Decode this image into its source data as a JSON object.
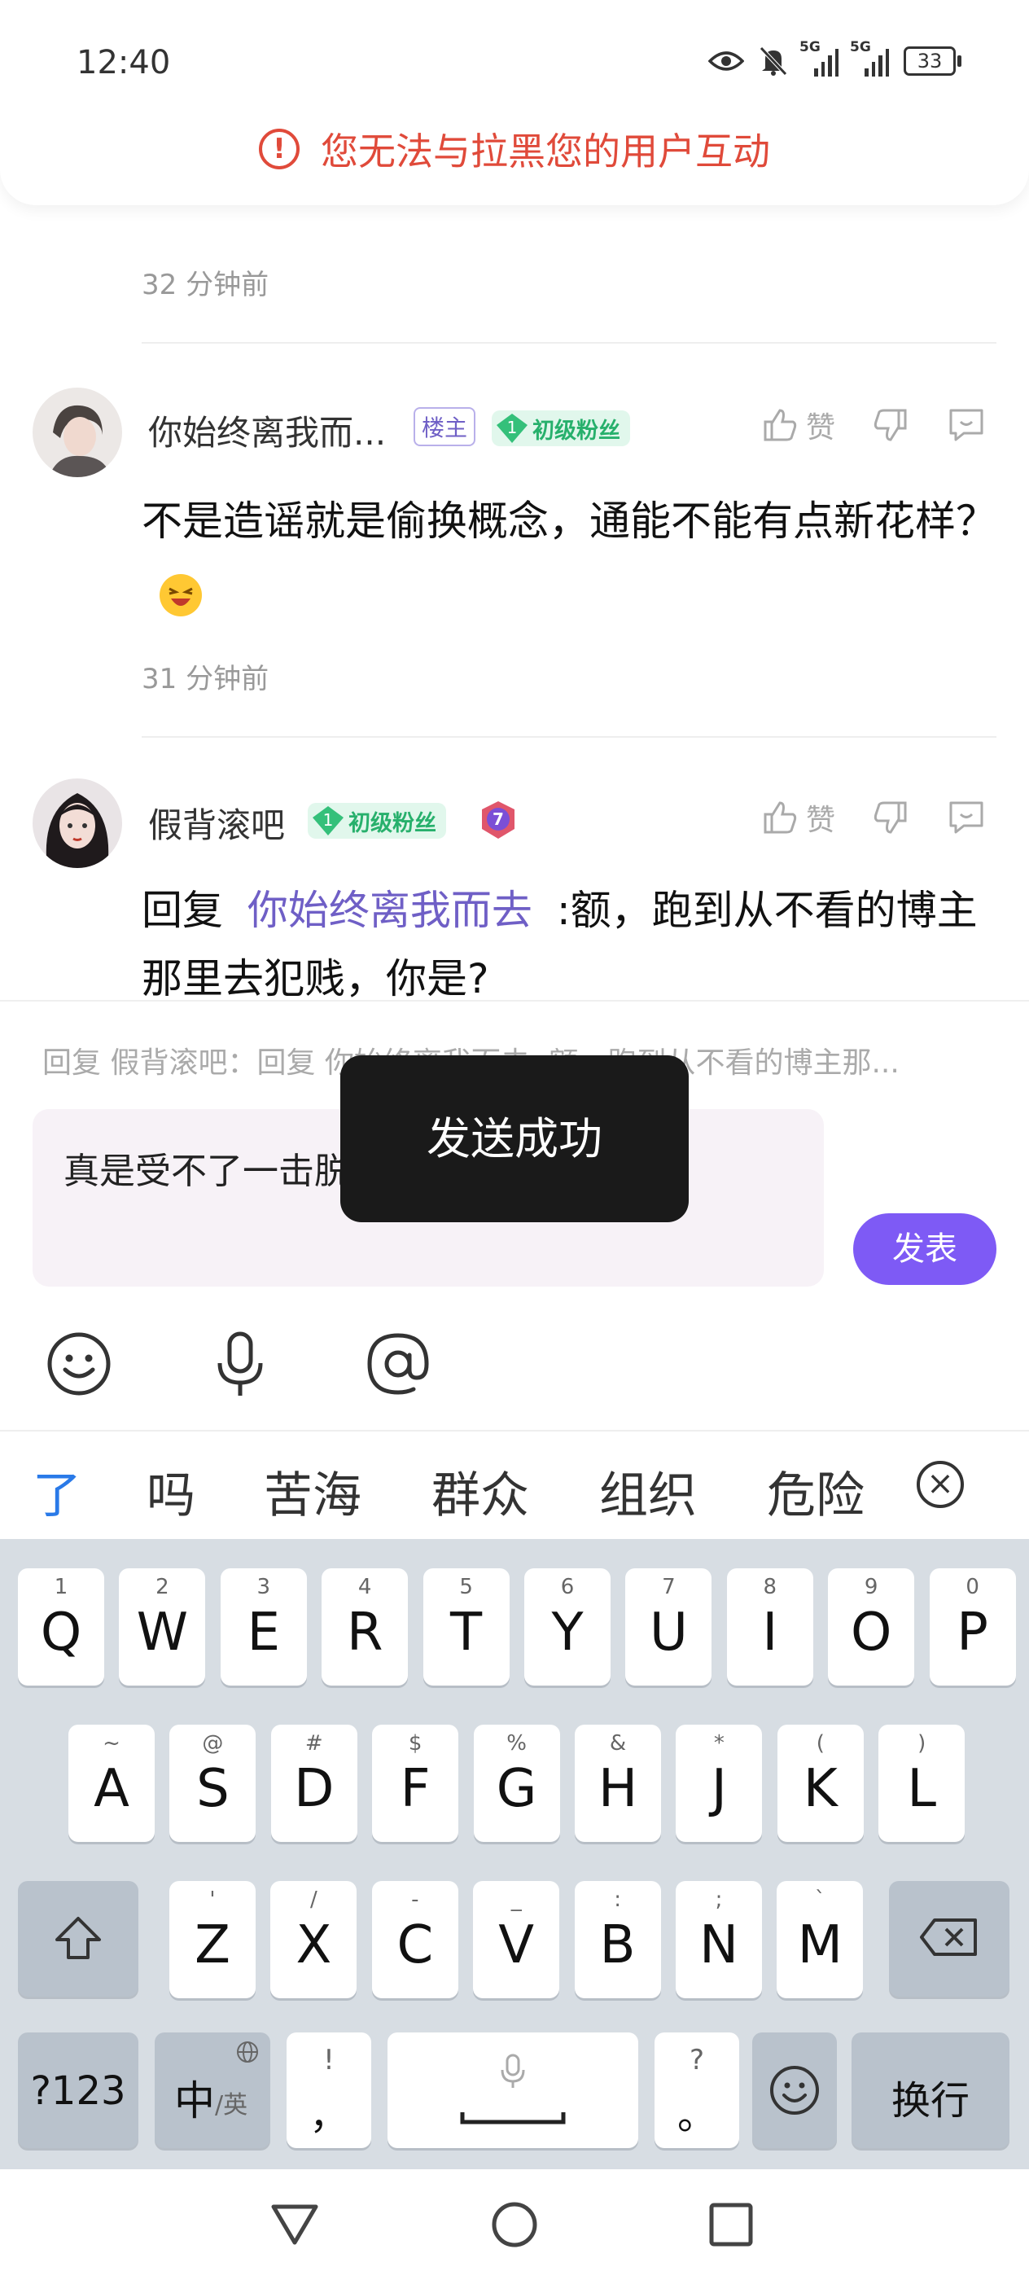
{
  "status_bar": {
    "time": "12:40",
    "sig1": "5G",
    "sig2": "5G",
    "battery": "33"
  },
  "banner": {
    "text": "您无法与拉黑您的用户互动"
  },
  "top_time": "32 分钟前",
  "comments": [
    {
      "name": "你始终离我而...",
      "owner_tag": "楼主",
      "fan_level": "1",
      "fan_label": "初级粉丝",
      "like_label": "赞",
      "text": "不是造谣就是偷换概念，通能不能有点新花样？",
      "time": "31 分钟前"
    },
    {
      "name": "假背滚吧",
      "fan_level": "1",
      "fan_label": "初级粉丝",
      "level_badge": "7",
      "like_label": "赞",
      "reply_prefix": "回复",
      "mention": "你始终离我而去",
      "text": ":额，跑到从不看的博主那里去犯贱，你是?"
    }
  ],
  "composer": {
    "reply_hint": "回复 假背滚吧：回复 你始终离我而去 :额，跑到从不看的博主那...",
    "input_value": "真是受不了一击脱离",
    "post_label": "发表"
  },
  "toast": "发送成功",
  "candidates": [
    "了",
    "吗",
    "苦海",
    "群众",
    "组织",
    "危险"
  ],
  "keyboard": {
    "row1": [
      [
        "Q",
        "1"
      ],
      [
        "W",
        "2"
      ],
      [
        "E",
        "3"
      ],
      [
        "R",
        "4"
      ],
      [
        "T",
        "5"
      ],
      [
        "Y",
        "6"
      ],
      [
        "U",
        "7"
      ],
      [
        "I",
        "8"
      ],
      [
        "O",
        "9"
      ],
      [
        "P",
        "0"
      ]
    ],
    "row2": [
      [
        "A",
        "~"
      ],
      [
        "S",
        "@"
      ],
      [
        "D",
        "#"
      ],
      [
        "F",
        "$"
      ],
      [
        "G",
        "%"
      ],
      [
        "H",
        "&"
      ],
      [
        "J",
        "*"
      ],
      [
        "K",
        "("
      ],
      [
        "L",
        ")"
      ]
    ],
    "row3": [
      [
        "Z",
        "'"
      ],
      [
        "X",
        "/"
      ],
      [
        "C",
        "-"
      ],
      [
        "V",
        "_"
      ],
      [
        "B",
        ":"
      ],
      [
        "N",
        ";"
      ],
      [
        "M",
        "`"
      ]
    ],
    "sym_label": "?123",
    "lang_main": "中",
    "lang_sub": "/英",
    "comma": "，",
    "comma_sub": "!",
    "period": "。",
    "period_sub": "?",
    "enter_label": "换行"
  }
}
